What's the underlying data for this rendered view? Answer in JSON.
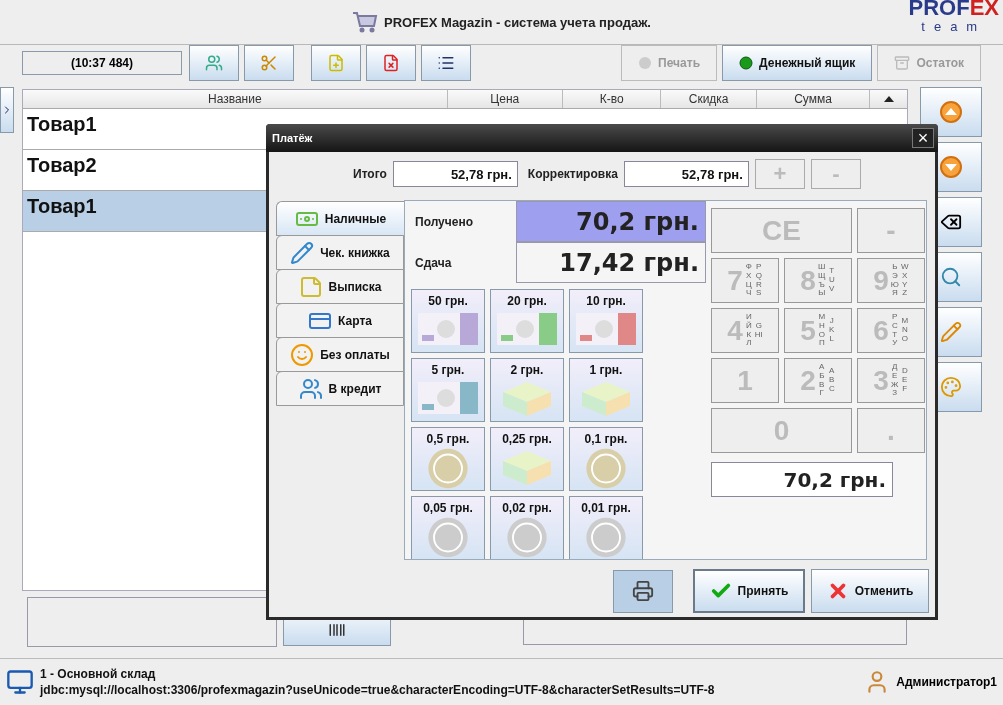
{
  "window": {
    "title": "PROFEX Magazin - система учета продаж.",
    "logo": "PROF",
    "logo_accent": "EX",
    "logo_sub": "team"
  },
  "toolbar": {
    "clock": "(10:37 484)",
    "actions": [
      {
        "label": "Печать",
        "disabled": true,
        "kind": "print"
      },
      {
        "label": "Денежный ящик",
        "disabled": false,
        "kind": "drawer"
      },
      {
        "label": "Остаток",
        "disabled": true,
        "kind": "rest"
      }
    ]
  },
  "table": {
    "columns": [
      "Название",
      "Цена",
      "К-во",
      "Скидка",
      "Сумма"
    ],
    "rows": [
      {
        "cells": [
          "Товар1"
        ],
        "selected": false
      },
      {
        "cells": [
          "Товар2"
        ],
        "selected": false
      },
      {
        "cells": [
          "Товар1"
        ],
        "selected": true
      }
    ]
  },
  "status_bar": {
    "warehouse": "1 - Основной склад",
    "connection": "jdbc:mysql://localhost:3306/profexmagazin?useUnicode=true&characterEncoding=UTF-8&characterSetResults=UTF-8",
    "user": "Администратор1"
  },
  "dialog": {
    "title": "Платёж",
    "close": "×",
    "total_label": "Итого",
    "total": "52,78 грн.",
    "correction_label": "Корректировка",
    "correction": "52,78 грн.",
    "adjust": [
      {
        "label": "+",
        "disabled": true
      },
      {
        "label": "-",
        "disabled": true
      }
    ],
    "tabs": [
      {
        "label": "Наличные",
        "selected": true,
        "kind": "cash"
      },
      {
        "label": "Чек. книжка",
        "selected": false,
        "kind": "cheque"
      },
      {
        "label": "Выписка",
        "selected": false,
        "kind": "note"
      },
      {
        "label": "Карта",
        "selected": false,
        "kind": "card"
      },
      {
        "label": "Без оплаты",
        "selected": false,
        "kind": "free"
      },
      {
        "label": "В кредит",
        "selected": false,
        "kind": "credit"
      }
    ],
    "received_label": "Получено",
    "received": "70,2 грн.",
    "change_label": "Сдача",
    "change": "17,42 грн.",
    "denominations": [
      {
        "label": "50 грн.",
        "kind": "banknote",
        "color": "#b8a8d8"
      },
      {
        "label": "20 грн.",
        "kind": "banknote",
        "color": "#88cc88"
      },
      {
        "label": "10 грн.",
        "kind": "banknote",
        "color": "#e08888"
      },
      {
        "label": "5 грн.",
        "kind": "banknote",
        "color": "#88b8c8"
      },
      {
        "label": "2 грн.",
        "kind": "stack"
      },
      {
        "label": "1 грн.",
        "kind": "stack"
      },
      {
        "label": "0,5 грн.",
        "kind": "coin",
        "color": "#d8cfa8"
      },
      {
        "label": "0,25 грн.",
        "kind": "stack"
      },
      {
        "label": "0,1 грн.",
        "kind": "coin",
        "color": "#d8cfa8"
      },
      {
        "label": "0,05 грн.",
        "kind": "coin",
        "color": "#cccccc"
      },
      {
        "label": "0,02 грн.",
        "kind": "coin",
        "color": "#cccccc"
      },
      {
        "label": "0,01 грн.",
        "kind": "coin",
        "color": "#cccccc"
      }
    ],
    "keypad": [
      {
        "label": "CE",
        "wide": true,
        "disabled": true
      },
      {
        "label": "-",
        "wide": false,
        "disabled": true
      },
      {
        "label": "7",
        "letters_ru": "ФХЦЧ",
        "letters_en": "PQRS",
        "wide": false,
        "disabled": true
      },
      {
        "label": "8",
        "letters_ru": "ШЩЪЫ",
        "letters_en": "TUV",
        "wide": false,
        "disabled": true
      },
      {
        "label": "9",
        "letters_ru": "ЬЭЮЯ",
        "letters_en": "WXYZ",
        "wide": false,
        "disabled": true
      },
      {
        "label": "4",
        "letters_ru": "ИЙКЛ",
        "letters_en": "GHI",
        "wide": false,
        "disabled": true
      },
      {
        "label": "5",
        "letters_ru": "МНОП",
        "letters_en": "JKL",
        "wide": false,
        "disabled": true
      },
      {
        "label": "6",
        "letters_ru": "РСТУ",
        "letters_en": "MNO",
        "wide": false,
        "disabled": true
      },
      {
        "label": "1",
        "wide": false,
        "disabled": true
      },
      {
        "label": "2",
        "letters_ru": "АБВГ",
        "letters_en": "ABC",
        "wide": false,
        "disabled": true
      },
      {
        "label": "3",
        "letters_ru": "ДЕЖЗ",
        "letters_en": "DEF",
        "wide": false,
        "disabled": true
      },
      {
        "label": "0",
        "wide": true,
        "disabled": true
      },
      {
        "label": ".",
        "wide": false,
        "disabled": true
      }
    ],
    "display": "70,2 грн.",
    "accept": "Принять",
    "cancel": "Отменить"
  }
}
